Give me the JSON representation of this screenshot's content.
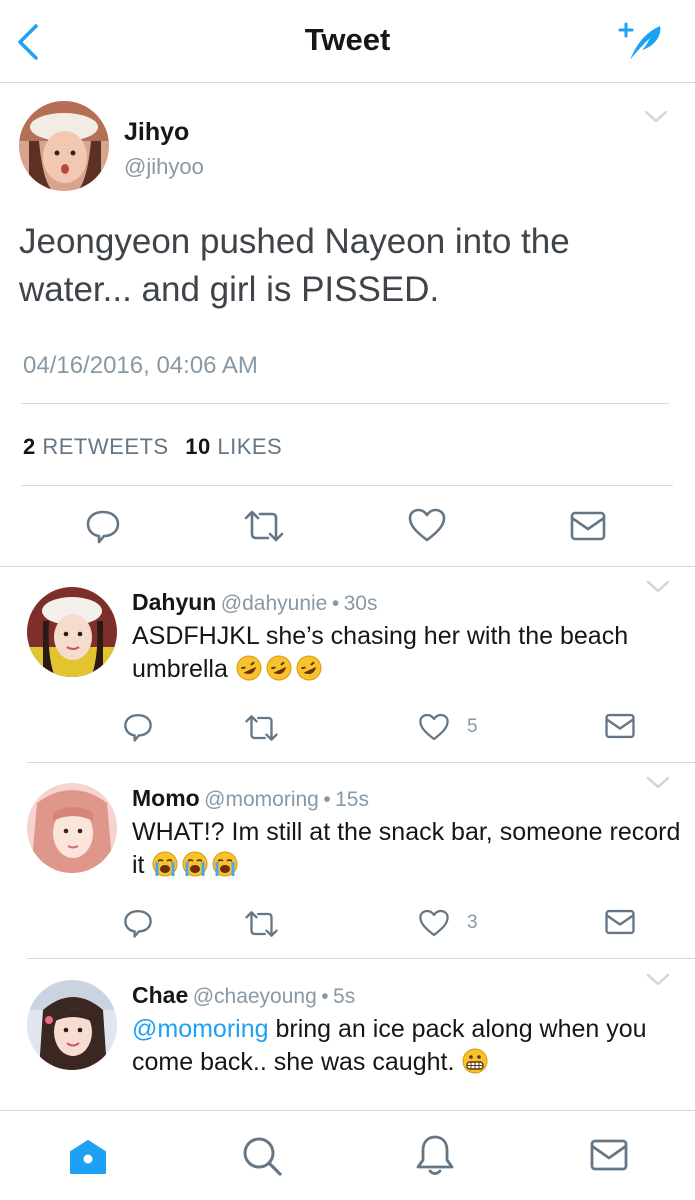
{
  "header": {
    "title": "Tweet"
  },
  "main_tweet": {
    "name": "Jihyo",
    "handle": "@jihyoo",
    "text": "Jeongyeon pushed Nayeon into the water... and girl is PISSED.",
    "timestamp": "04/16/2016, 04:06 AM",
    "retweets_count": "2",
    "retweets_label": "RETWEETS",
    "likes_count": "10",
    "likes_label": "LIKES"
  },
  "replies": [
    {
      "name": "Dahyun",
      "handle": "@dahyunie",
      "time": "30s",
      "text": "ASDFHJKL she’s chasing her with the beach umbrella",
      "emoji": "rolling-on-floor-laughing",
      "likes": "5"
    },
    {
      "name": "Momo",
      "handle": "@momoring",
      "time": "15s",
      "text": "WHAT!? Im still at the snack bar, someone record it",
      "emoji": "loudly-crying",
      "likes": "3"
    },
    {
      "name": "Chae",
      "handle": "@chaeyoung",
      "time": "5s",
      "mention": "@momoring",
      "text": " bring an ice pack along when you come back.. she was caught.",
      "emoji": "grimacing"
    }
  ],
  "separator": "•",
  "colors": {
    "accent": "#1da1f2",
    "icon": "#657786",
    "muted": "#8899a6",
    "divider": "#d6d9dc"
  },
  "icons": [
    "back-chevron",
    "compose-feather",
    "reply",
    "retweet",
    "like-heart",
    "direct-message",
    "home",
    "search",
    "notifications",
    "messages"
  ]
}
